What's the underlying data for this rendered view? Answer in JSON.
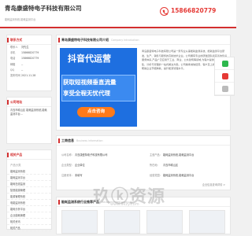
{
  "header": {
    "company": "青岛康盛特电子科技有限公司",
    "slogan": "能耗监测系统,能耗监测平台",
    "phone": "15866820779"
  },
  "contact": {
    "title": "联系方式",
    "rows": [
      {
        "k": "联系人",
        "v": "刘先生"
      },
      {
        "k": "手机",
        "v": "15866820779"
      },
      {
        "k": "电话",
        "v": "15866820779"
      },
      {
        "k": "邮箱",
        "v": "--"
      },
      {
        "k": "QQ",
        "v": "--"
      },
      {
        "k": "发布时间",
        "v": "2021.11.28"
      }
    ]
  },
  "address": {
    "title": "公司地址",
    "text": "青岛市崂山区 能耗监测系统,能耗监测平台..."
  },
  "products": {
    "title": "相关产品",
    "label": "产品分类",
    "items": [
      "能耗监测系统",
      "能耗监测平台",
      "能耗在线监测",
      "智慧能源管理",
      "能源管理系统",
      "电能监测系统",
      "能耗分析平台",
      "企业能耗管理",
      "相关资讯",
      "相关产品"
    ]
  },
  "intro": {
    "title": "青岛康盛特电子科技有限公司介绍",
    "title_en": "Company Introduction",
    "banner_big": "抖音代运营",
    "banner_line1": "获取短视频垂直流量",
    "banner_line2": "享受全程无忧代理",
    "banner_button": "点击咨询",
    "body": "青岛康盛特电子科技有限公司是一家专业从事能耗监测系统、能耗监测平台研发、生产、销售与服务的高新技术企业。公司拥有专业的研发团队和完善的售后服务体系,产品广泛应用于工业、商业、公共建筑等领域,为客户提供能源数据采集、分析与管理的一站式解决方案。公司秉承诚信经营、客户至上的理念,致力于帮助企业节能降耗、提升能源管理水平。"
  },
  "business": {
    "title": "工商信息",
    "title_en": "Business information",
    "rows": [
      [
        {
          "k": "公司名称:",
          "v": "青岛康盛特电子科技有限公司"
        },
        {
          "k": "主营产品:",
          "v": "能耗监测系统,能耗监测平台"
        }
      ],
      [
        {
          "k": "企业类型:",
          "v": "企业单位"
        },
        {
          "k": "所在地:",
          "v": "青岛市崂山区"
        }
      ],
      [
        {
          "k": "注册资本:",
          "v": "未填写"
        },
        {
          "k": "经营范围:",
          "v": "能耗监测系统,能耗监测平台"
        }
      ]
    ],
    "more": "企业信息查询详情 >"
  },
  "recommend": {
    "title": "能耗监测系统行业推荐产品",
    "title_en": "Recommended products"
  },
  "watermark": {
    "big": "玖ⓚ资源",
    "sub": "www.9kzy.com"
  },
  "colors": {
    "accent": "#d32f2f",
    "banner": "#1e6fe0",
    "button": "#ff7a1a",
    "wechat": "#2db84d"
  }
}
